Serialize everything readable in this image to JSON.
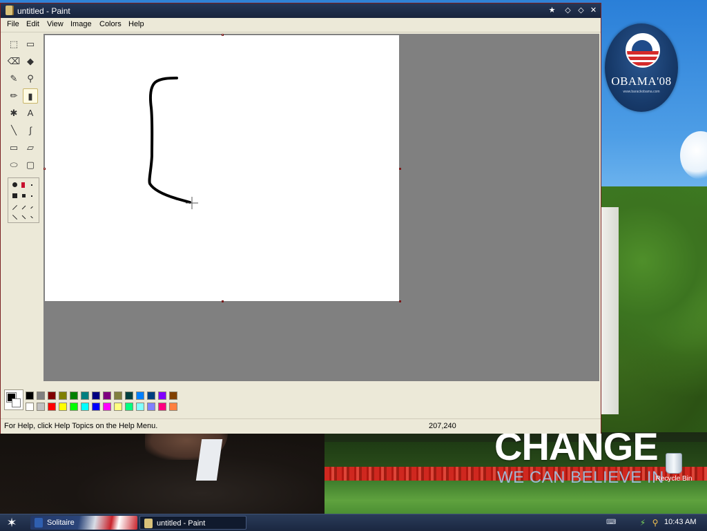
{
  "window": {
    "title": "untitled - Paint",
    "controls": {
      "pin": "★",
      "restore": "◇",
      "maximize": "◇",
      "close": "✕"
    }
  },
  "menu": [
    "File",
    "Edit",
    "View",
    "Image",
    "Colors",
    "Help"
  ],
  "tools": [
    {
      "name": "free-form-select-icon",
      "glyph": "⬚"
    },
    {
      "name": "select-icon",
      "glyph": "▭"
    },
    {
      "name": "eraser-icon",
      "glyph": "⌫"
    },
    {
      "name": "fill-with-color-icon",
      "glyph": "◆"
    },
    {
      "name": "pick-color-icon",
      "glyph": "✎"
    },
    {
      "name": "magnifier-icon",
      "glyph": "⚲"
    },
    {
      "name": "pencil-icon",
      "glyph": "✏"
    },
    {
      "name": "brush-icon",
      "glyph": "▮"
    },
    {
      "name": "airbrush-icon",
      "glyph": "✱"
    },
    {
      "name": "text-icon",
      "glyph": "A"
    },
    {
      "name": "line-icon",
      "glyph": "╲"
    },
    {
      "name": "curve-icon",
      "glyph": "∫"
    },
    {
      "name": "rectangle-icon",
      "glyph": "▭"
    },
    {
      "name": "polygon-icon",
      "glyph": "▱"
    },
    {
      "name": "ellipse-icon",
      "glyph": "⬭"
    },
    {
      "name": "rounded-rectangle-icon",
      "glyph": "▢"
    }
  ],
  "selected_tool": "brush-icon",
  "colors": {
    "foreground": "#000000",
    "background": "#ffffff",
    "palette_top": [
      "#000000",
      "#808080",
      "#800000",
      "#808000",
      "#008000",
      "#008080",
      "#000080",
      "#800080",
      "#808040",
      "#004040",
      "#0080ff",
      "#004080",
      "#8000ff",
      "#804000"
    ],
    "palette_bottom": [
      "#ffffff",
      "#c0c0c0",
      "#ff0000",
      "#ffff00",
      "#00ff00",
      "#00ffff",
      "#0000ff",
      "#ff00ff",
      "#ffff80",
      "#00ff80",
      "#80ffff",
      "#8080ff",
      "#ff0080",
      "#ff8040"
    ]
  },
  "status": {
    "help": "For Help, click Help Topics on the Help Menu.",
    "coords": "207,240"
  },
  "desktop": {
    "logo_word": "OBAMA'08",
    "logo_small": "www.barackobama.com",
    "slogan_main": "CHANGE",
    "slogan_sub": "WE CAN BELIEVE IN",
    "recycle_bin": "Recycle Bin"
  },
  "taskbar": {
    "start_glyph": "✶",
    "tasks": [
      "Solitaire",
      "untitled - Paint"
    ],
    "tray": [
      "⚡",
      "⚲"
    ],
    "clock": "10:43 AM"
  }
}
